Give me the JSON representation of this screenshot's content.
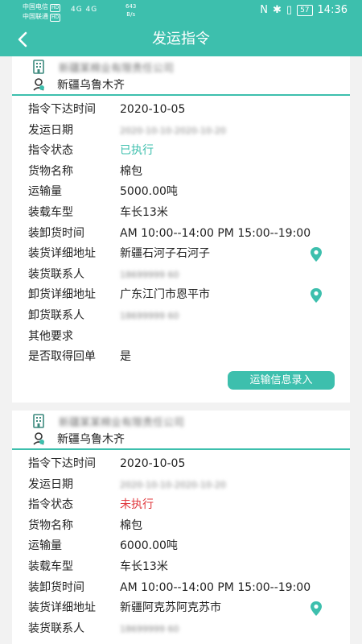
{
  "status": {
    "carrier1": "中国电信",
    "carrier2": "中国联通",
    "hd": "HD",
    "signal": "4G 4G",
    "speed_value": "643",
    "speed_unit": "B/s",
    "battery": "57",
    "time": "14:36"
  },
  "header": {
    "title": "发运指令"
  },
  "cards": [
    {
      "company": "新疆某棉业有限责任公司",
      "destination": "新疆乌鲁木齐",
      "fields": [
        {
          "label": "指令下达时间",
          "value": "2020-10-05"
        },
        {
          "label": "发运日期",
          "value": "2020-10-10-2020-10-20"
        },
        {
          "label": "指令状态",
          "value": "已执行"
        },
        {
          "label": "货物名称",
          "value": "棉包"
        },
        {
          "label": "运输量",
          "value": "5000.00吨"
        },
        {
          "label": "装载车型",
          "value": "车长13米"
        },
        {
          "label": "装卸货时间",
          "value": "AM 10:00--14:00 PM 15:00--19:00"
        },
        {
          "label": "装货详细地址",
          "value": "新疆石河子石河子"
        },
        {
          "label": "装货联系人",
          "value": "18699999 60"
        },
        {
          "label": "卸货详细地址",
          "value": "广东江门市恩平市"
        },
        {
          "label": "卸货联系人",
          "value": "18699999 60"
        },
        {
          "label": "其他要求",
          "value": ""
        },
        {
          "label": "是否取得回单",
          "value": "是"
        }
      ],
      "action_label": "运输信息录入"
    },
    {
      "company": "新疆某某棉业有限责任公司",
      "destination": "新疆乌鲁木齐",
      "fields": [
        {
          "label": "指令下达时间",
          "value": "2020-10-05"
        },
        {
          "label": "发运日期",
          "value": "2020-10-10-2020-10-20"
        },
        {
          "label": "指令状态",
          "value": "未执行"
        },
        {
          "label": "货物名称",
          "value": "棉包"
        },
        {
          "label": "运输量",
          "value": "6000.00吨"
        },
        {
          "label": "装载车型",
          "value": "车长13米"
        },
        {
          "label": "装卸货时间",
          "value": "AM 10:00--14:00 PM 15:00--19:00"
        },
        {
          "label": "装货详细地址",
          "value": "新疆阿克苏阿克苏市"
        },
        {
          "label": "装货联系人",
          "value": "18699999 60"
        }
      ]
    }
  ],
  "colors": {
    "accent": "#3dbfad",
    "done": "#3dbfad",
    "pending": "#e0393e"
  },
  "icons": {
    "back": "chevron-left-icon",
    "company": "building-icon",
    "destination": "location-person-icon",
    "map": "map-pin-icon"
  }
}
